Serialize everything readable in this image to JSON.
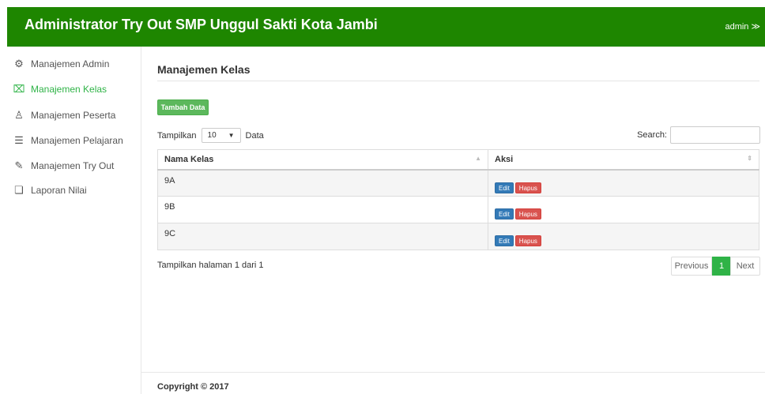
{
  "header": {
    "title": "Administrator Try Out SMP Unggul Sakti Kota Jambi",
    "user_label": "admin ≫"
  },
  "sidebar": {
    "items": [
      {
        "label": "Manajemen Admin",
        "icon": "gear-icon",
        "glyph": "⚙",
        "active": false
      },
      {
        "label": "Manajemen Kelas",
        "icon": "flag-icon",
        "glyph": "⌧",
        "active": true
      },
      {
        "label": "Manajemen Peserta",
        "icon": "user-icon",
        "glyph": "♙",
        "active": false
      },
      {
        "label": "Manajemen Pelajaran",
        "icon": "book-icon",
        "glyph": "☰",
        "active": false
      },
      {
        "label": "Manajemen Try Out",
        "icon": "edit-icon",
        "glyph": "✎",
        "active": false
      },
      {
        "label": "Laporan Nilai",
        "icon": "report-icon",
        "glyph": "❏",
        "active": false
      }
    ]
  },
  "main": {
    "page_title": "Manajemen Kelas",
    "add_button": "Tambah Data",
    "length": {
      "prefix": "Tampilkan",
      "value": "10",
      "suffix": "Data"
    },
    "search": {
      "label": "Search:",
      "value": "",
      "placeholder": ""
    },
    "table": {
      "columns": [
        "Nama Kelas",
        "Aksi"
      ],
      "rows": [
        {
          "name": "9A",
          "edit": "Edit",
          "delete": "Hapus"
        },
        {
          "name": "9B",
          "edit": "Edit",
          "delete": "Hapus"
        },
        {
          "name": "9C",
          "edit": "Edit",
          "delete": "Hapus"
        }
      ]
    },
    "info": "Tampilkan halaman 1 dari 1",
    "pagination": {
      "previous": "Previous",
      "current": "1",
      "next": "Next"
    }
  },
  "footer": {
    "copyright": "Copyright © 2017"
  },
  "colors": {
    "header_bg": "#1e8600",
    "accent": "#2fb347",
    "edit_button": "#337ab7",
    "delete_button": "#d9534f",
    "add_button": "#5cb85c"
  }
}
